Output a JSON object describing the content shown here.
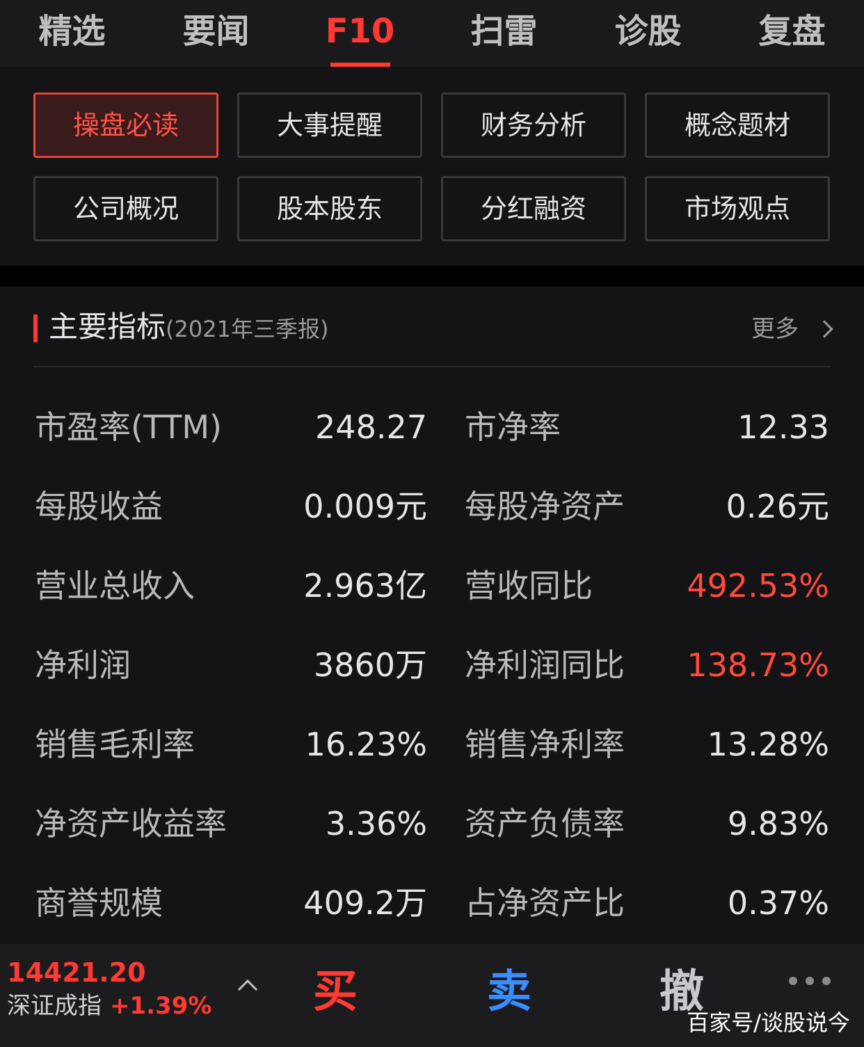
{
  "top_tabs": [
    {
      "label": "精选"
    },
    {
      "label": "要闻"
    },
    {
      "label": "F10"
    },
    {
      "label": "扫雷"
    },
    {
      "label": "诊股"
    },
    {
      "label": "复盘"
    }
  ],
  "modules": [
    {
      "label": "操盘必读"
    },
    {
      "label": "大事提醒"
    },
    {
      "label": "财务分析"
    },
    {
      "label": "概念题材"
    },
    {
      "label": "公司概况"
    },
    {
      "label": "股本股东"
    },
    {
      "label": "分红融资"
    },
    {
      "label": "市场观点"
    }
  ],
  "section": {
    "title": "主要指标",
    "subtitle": "(2021年三季报)",
    "more_label": "更多"
  },
  "metrics": [
    [
      {
        "label": "市盈率(TTM)",
        "value": "248.27"
      },
      {
        "label": "市净率",
        "value": "12.33"
      }
    ],
    [
      {
        "label": "每股收益",
        "value": "0.009元"
      },
      {
        "label": "每股净资产",
        "value": "0.26元"
      }
    ],
    [
      {
        "label": "营业总收入",
        "value": "2.963亿"
      },
      {
        "label": "营收同比",
        "value": "492.53%",
        "color": "#ff4a3d"
      }
    ],
    [
      {
        "label": "净利润",
        "value": "3860万"
      },
      {
        "label": "净利润同比",
        "value": "138.73%",
        "color": "#ff4a3d"
      }
    ],
    [
      {
        "label": "销售毛利率",
        "value": "16.23%"
      },
      {
        "label": "销售净利率",
        "value": "13.28%"
      }
    ],
    [
      {
        "label": "净资产收益率",
        "value": "3.36%"
      },
      {
        "label": "资产负债率",
        "value": "9.83%"
      }
    ],
    [
      {
        "label": "商誉规模",
        "value": "409.2万"
      },
      {
        "label": "占净资产比",
        "value": "0.37%"
      }
    ]
  ],
  "bottom": {
    "index_value": "14421.20",
    "index_name": "深证成指",
    "index_change": "+1.39%",
    "buy_label": "买",
    "sell_label": "卖",
    "cancel_label": "撤",
    "watermark": "百家号/谈股说今"
  },
  "colors": {
    "accent": "#ff3a33",
    "sell": "#3a8cff",
    "background": "#141416"
  },
  "icons": [
    "chevron-right-icon",
    "chevron-up-icon",
    "more-dots-icon"
  ]
}
